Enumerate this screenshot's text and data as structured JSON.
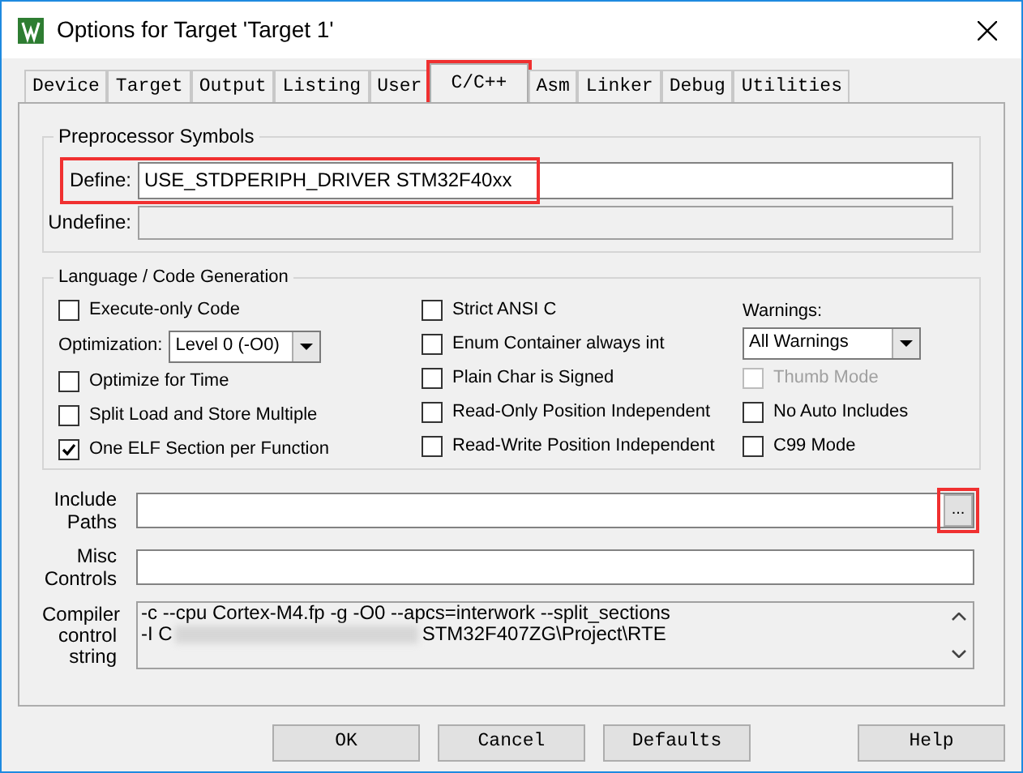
{
  "window": {
    "title": "Options for Target 'Target 1'"
  },
  "tabs": [
    {
      "label": "Device",
      "selected": false,
      "highlighted": false
    },
    {
      "label": "Target",
      "selected": false,
      "highlighted": false
    },
    {
      "label": "Output",
      "selected": false,
      "highlighted": false
    },
    {
      "label": "Listing",
      "selected": false,
      "highlighted": false
    },
    {
      "label": "User",
      "selected": false,
      "highlighted": false
    },
    {
      "label": "C/C++",
      "selected": true,
      "highlighted": true
    },
    {
      "label": "Asm",
      "selected": false,
      "highlighted": false
    },
    {
      "label": "Linker",
      "selected": false,
      "highlighted": false
    },
    {
      "label": "Debug",
      "selected": false,
      "highlighted": false
    },
    {
      "label": "Utilities",
      "selected": false,
      "highlighted": false
    }
  ],
  "preprocessor": {
    "title": "Preprocessor Symbols",
    "define": {
      "label": "Define:",
      "value": "USE_STDPERIPH_DRIVER STM32F40xx",
      "highlighted": true,
      "disabled": false
    },
    "undefine": {
      "label": "Undefine:",
      "disabled": true
    }
  },
  "language": {
    "title": "Language / Code Generation",
    "columns": [
      [
        {
          "kind": "checkbox",
          "label": "Execute-only Code",
          "checked": false,
          "disabled": false
        },
        {
          "kind": "select",
          "label": "Optimization:",
          "value": "Level 0 (-O0)"
        },
        {
          "kind": "checkbox",
          "label": "Optimize for Time",
          "checked": false,
          "disabled": false
        },
        {
          "kind": "checkbox",
          "label": "Split Load and Store Multiple",
          "checked": false,
          "disabled": false
        },
        {
          "kind": "checkbox",
          "label": "One ELF Section per Function",
          "checked": true,
          "disabled": false
        }
      ],
      [
        {
          "kind": "checkbox",
          "label": "Strict ANSI C",
          "checked": false,
          "disabled": false
        },
        {
          "kind": "checkbox",
          "label": "Enum Container always int",
          "checked": false,
          "disabled": false
        },
        {
          "kind": "checkbox",
          "label": "Plain Char is Signed",
          "checked": false,
          "disabled": false
        },
        {
          "kind": "checkbox",
          "label": "Read-Only Position Independent",
          "checked": false,
          "disabled": false
        },
        {
          "kind": "checkbox",
          "label": "Read-Write Position Independent",
          "checked": false,
          "disabled": false
        }
      ],
      [
        {
          "kind": "label",
          "label": "Warnings:"
        },
        {
          "kind": "select",
          "value": "All Warnings"
        },
        {
          "kind": "checkbox",
          "label": "Thumb Mode",
          "checked": false,
          "disabled": true
        },
        {
          "kind": "checkbox",
          "label": "No Auto Includes",
          "checked": false,
          "disabled": false
        },
        {
          "kind": "checkbox",
          "label": "C99 Mode",
          "checked": false,
          "disabled": false
        }
      ]
    ]
  },
  "include_paths": {
    "label": "Include Paths",
    "browse": "...",
    "browse_highlighted": true
  },
  "misc_controls": {
    "label": "Misc Controls"
  },
  "compiler_string": {
    "label": "Compiler control string",
    "line_1": "-c --cpu Cortex-M4.fp -g -O0 --apcs=interwork --split_sections",
    "line_2_start": "-I C",
    "line_2_end": "STM32F407ZG\\Project\\RTE"
  },
  "buttons": [
    "OK",
    "Cancel",
    "Defaults",
    "Help"
  ]
}
